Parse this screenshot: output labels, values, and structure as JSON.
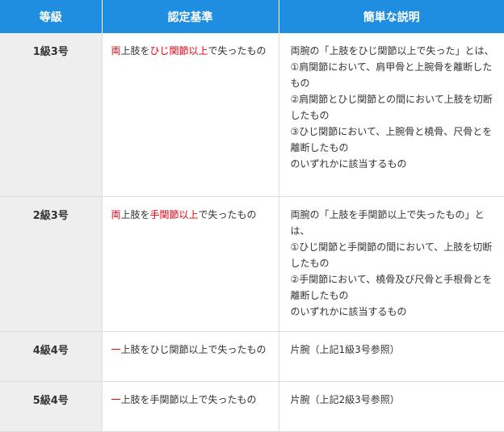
{
  "table": {
    "headers": [
      "等級",
      "認定基準",
      "簡単な説明"
    ],
    "rows": [
      {
        "grade": "1級3号",
        "criteria": [
          {
            "text": "両",
            "hl": true
          },
          {
            "text": "上肢を",
            "hl": false
          },
          {
            "text": "ひじ関節以上",
            "hl": true
          },
          {
            "text": "で失ったもの",
            "hl": false
          }
        ],
        "description": [
          "両腕の「上肢をひじ関節以上で失った」とは、",
          "①肩関節において、肩甲骨と上腕骨を離断したもの",
          "②肩関節とひじ関節との間において上肢を切断したもの",
          "③ひじ関節において、上腕骨と橈骨、尺骨とを離断したもの",
          "のいずれかに該当するもの"
        ]
      },
      {
        "grade": "2級3号",
        "criteria": [
          {
            "text": "両",
            "hl": true
          },
          {
            "text": "上肢を",
            "hl": false
          },
          {
            "text": "手関節以上",
            "hl": true
          },
          {
            "text": "で失ったもの",
            "hl": false
          }
        ],
        "description": [
          "両腕の「上肢を手関節以上で失ったもの」とは、",
          "①ひじ関節と手関節の間において、上肢を切断したもの",
          "②手関節において、橈骨及び尺骨と手根骨とを離断したもの",
          "のいずれかに該当するもの"
        ]
      },
      {
        "grade": "4級4号",
        "criteria": [
          {
            "text": "一",
            "hl": true
          },
          {
            "text": "上肢をひじ関節以上で失ったもの",
            "hl": false
          }
        ],
        "description": [
          "片腕（上記1級3号参照）"
        ]
      },
      {
        "grade": "5級4号",
        "criteria": [
          {
            "text": "一",
            "hl": true
          },
          {
            "text": "上肢を手関節以上で失ったもの",
            "hl": false
          }
        ],
        "description": [
          "片腕（上記2級3号参照）"
        ]
      }
    ]
  },
  "colors": {
    "header_bg": "#1f8de0",
    "header_text": "#ffffff",
    "grade_bg": "#eeeeee",
    "highlight": "#e60012",
    "border": "#dddddd"
  }
}
